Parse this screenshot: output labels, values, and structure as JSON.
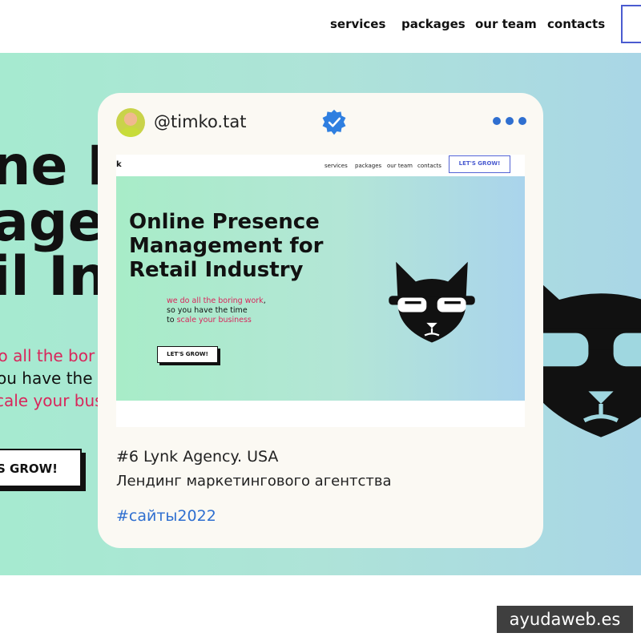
{
  "nav": {
    "items": [
      {
        "label": "services"
      },
      {
        "label": "packages"
      },
      {
        "label": "our team"
      },
      {
        "label": "contacts"
      }
    ]
  },
  "hero": {
    "title_lines": [
      "ne P",
      "agen",
      "il In"
    ],
    "sub_lines": [
      "lo all the bor",
      "ou have the t",
      "cale your bus"
    ],
    "button_label": "S GROW!",
    "colors": {
      "accent": "#d8265b",
      "text": "#111111"
    }
  },
  "post": {
    "handle": "@timko.tat",
    "verified_icon": "verified-badge-icon",
    "more_icon": "more-dots-icon",
    "preview": {
      "logo": "k",
      "nav_links": [
        "services",
        "packages",
        "our team",
        "contacts"
      ],
      "cta": "LET'S GROW!",
      "title_lines": [
        "Online Presence",
        "Management for",
        "Retail Industry"
      ],
      "sub_lines": [
        "we do all the boring work,",
        "so you have the time",
        "to scale your business"
      ],
      "sub_line_parts": {
        "line1_accent": "we do all the boring work",
        "line1_rest": ",",
        "line2": "so you have the time",
        "line3_prefix": "to ",
        "line3_accent": "scale your business"
      },
      "button": "LET'S GROW!"
    },
    "caption_line1": "#6 Lynk Agency. USA",
    "caption_line2": "Лендинг маркетингового агентства",
    "hashtag": "#сайты2022",
    "colors": {
      "hashtag": "#2f6fd0",
      "card_bg": "#fbf9f3"
    }
  },
  "watermark": "ayudaweb.es"
}
